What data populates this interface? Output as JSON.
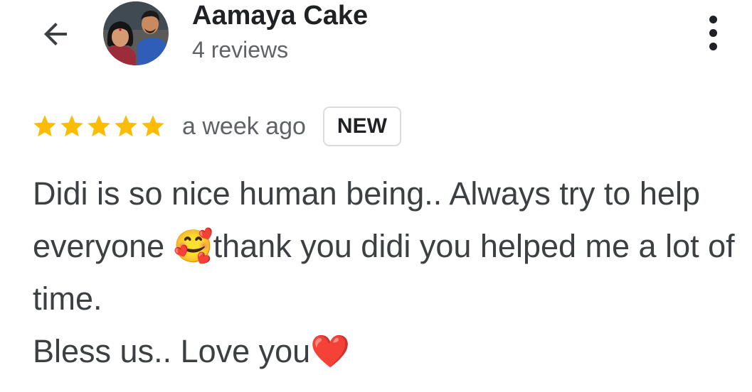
{
  "header": {
    "back_icon": "arrow-left-icon",
    "avatar_alt": "Aamaya Cake",
    "reviewer_name": "Aamaya Cake",
    "reviewer_meta": "4 reviews",
    "more_icon": "more-vert-icon"
  },
  "review": {
    "rating": 5,
    "rating_max": 5,
    "star_color": "#fbbc04",
    "star_icon": "star-icon",
    "time": "a week ago",
    "badge": "NEW",
    "text": "Didi is so nice human being.. Always try to help everyone 🥰thank you didi you helped me a lot of time.\nBless us.. Love you❤️"
  }
}
